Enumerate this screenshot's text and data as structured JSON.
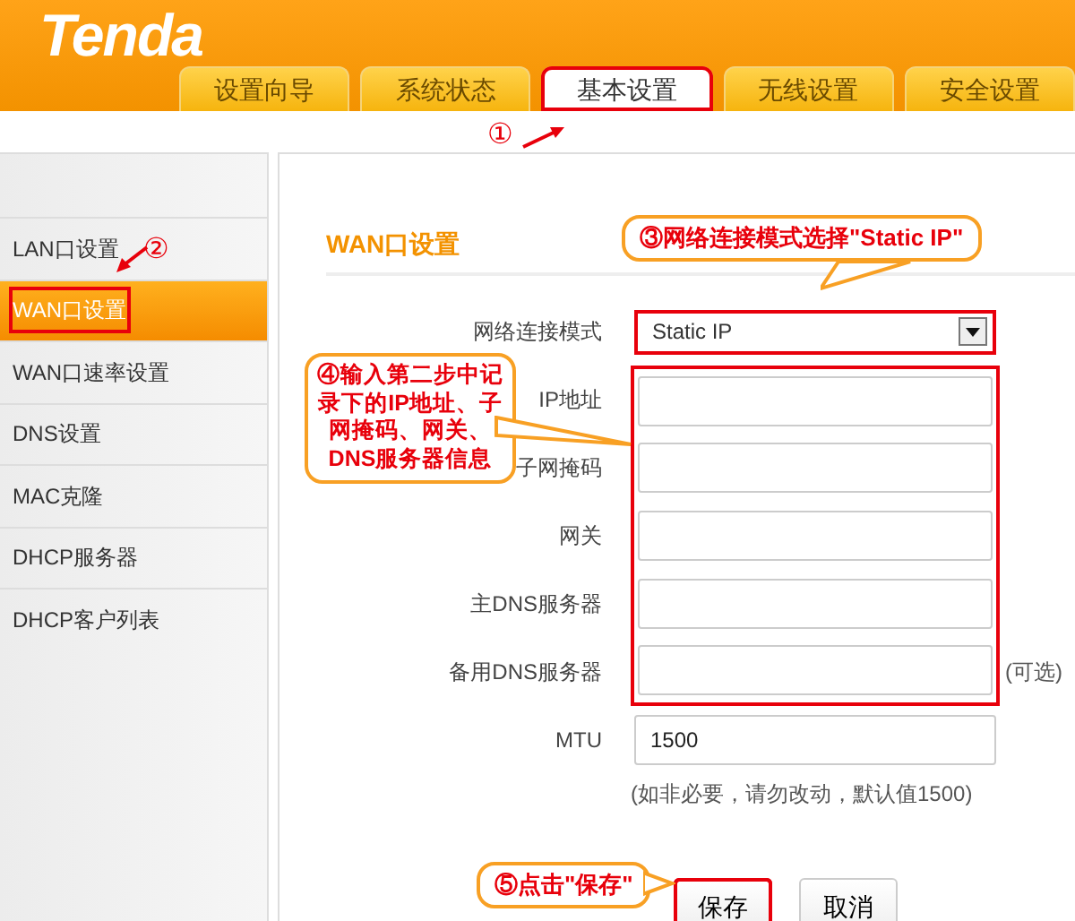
{
  "logo": "Tenda",
  "tabs": [
    {
      "label": "设置向导",
      "selected": false,
      "highlighted": false
    },
    {
      "label": "系统状态",
      "selected": false,
      "highlighted": false
    },
    {
      "label": "基本设置",
      "selected": true,
      "highlighted": true
    },
    {
      "label": "无线设置",
      "selected": false,
      "highlighted": false
    },
    {
      "label": "安全设置",
      "selected": false,
      "highlighted": false
    }
  ],
  "sidebar": {
    "items": [
      {
        "label": "LAN口设置",
        "selected": false,
        "highlighted": false
      },
      {
        "label": "WAN口设置",
        "selected": true,
        "highlighted": true
      },
      {
        "label": "WAN口速率设置",
        "selected": false,
        "highlighted": false
      },
      {
        "label": "DNS设置",
        "selected": false,
        "highlighted": false
      },
      {
        "label": "MAC克隆",
        "selected": false,
        "highlighted": false
      },
      {
        "label": "DHCP服务器",
        "selected": false,
        "highlighted": false
      },
      {
        "label": "DHCP客户列表",
        "selected": false,
        "highlighted": false
      }
    ]
  },
  "panel": {
    "title": "WAN口设置",
    "fields": [
      {
        "label": "网络连接模式",
        "kind": "select",
        "value": "Static IP",
        "highlighted": true
      },
      {
        "label": "IP地址",
        "kind": "input",
        "highlighted": true
      },
      {
        "label": "子网掩码",
        "kind": "input",
        "highlighted": true
      },
      {
        "label": "网关",
        "kind": "input",
        "highlighted": true
      },
      {
        "label": "主DNS服务器",
        "kind": "input",
        "highlighted": true
      },
      {
        "label": "备用DNS服务器",
        "kind": "input",
        "highlighted": true,
        "note": "(可选)"
      },
      {
        "label": "MTU",
        "kind": "input",
        "value": "1500",
        "highlighted": false,
        "hint": "(如非必要，请勿改动，默认值1500)"
      }
    ],
    "buttons": [
      {
        "label": "保存",
        "highlighted": true
      },
      {
        "label": "取消",
        "highlighted": false
      }
    ]
  },
  "annotations": [
    {
      "kind": "marker",
      "text": "①"
    },
    {
      "kind": "marker",
      "text": "②"
    },
    {
      "kind": "callout",
      "text": "③网络连接模式选择\"Static IP\""
    },
    {
      "kind": "callout",
      "text": "④输入第二步中记录下的IP地址、子网掩码、网关、DNS服务器信息"
    },
    {
      "kind": "callout",
      "text": "⑤点击\"保存\""
    }
  ]
}
